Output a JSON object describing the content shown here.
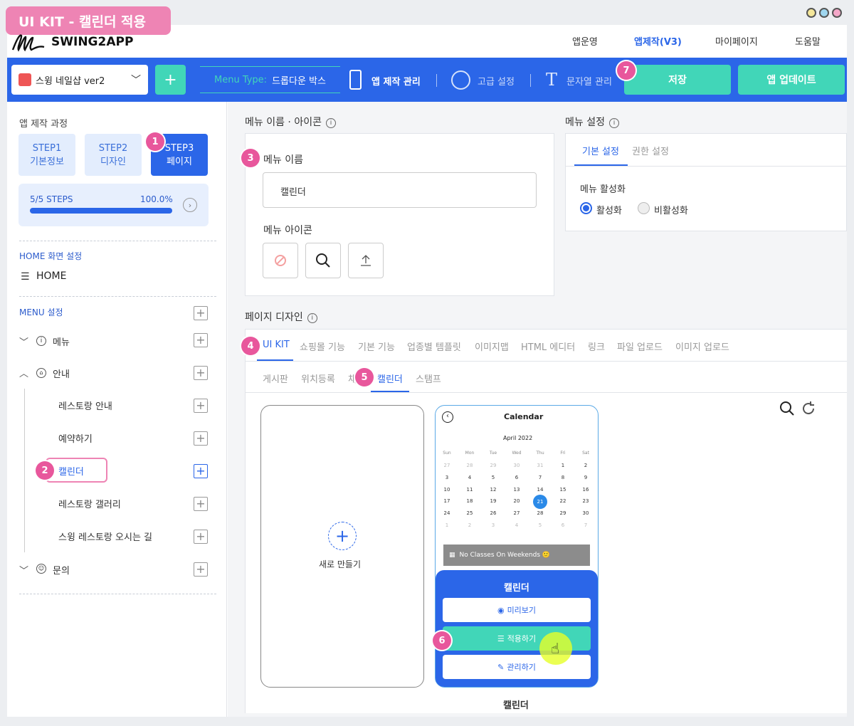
{
  "tag": "UI KIT - 캘린더 적용",
  "brand": "SWING2APP",
  "topnav": [
    "앱운영",
    "앱제작(V3)",
    "마이페이지",
    "도움말"
  ],
  "app_select": "스윙 네일샵 ver2",
  "add_label": "+",
  "menu_type_label": "Menu Type:",
  "menu_type_value": "드롭다운 박스",
  "app_manage": "앱 제작 관리",
  "advanced": "고급 설정",
  "strings_manage": "문자열 관리",
  "save": "저장",
  "update": "앱 업데이트",
  "badges": [
    "1",
    "2",
    "3",
    "4",
    "5",
    "6",
    "7"
  ],
  "sidebar": {
    "process_title": "앱 제작 과정",
    "steps": [
      [
        "STEP1",
        "기본정보"
      ],
      [
        "STEP2",
        "디자인"
      ],
      [
        "STEP3",
        "페이지"
      ]
    ],
    "progress_label": "5/5 STEPS",
    "progress_pct": "100.0%",
    "progress_value": 1.0,
    "home_title": "HOME 화면 설정",
    "home_item": "HOME",
    "menu_title": "MENU 설정",
    "tree": [
      "메뉴",
      "안내",
      "레스토랑 안내",
      "예약하기",
      "캘린더",
      "레스토랑 갤러리",
      "스윙 레스토랑 오시는 길",
      "문의"
    ]
  },
  "menu_name_icon": {
    "title": "메뉴 이름 · 아이콘",
    "name_label": "메뉴 이름",
    "name_value": "캘린더",
    "icon_label": "메뉴 아이콘"
  },
  "menu_settings": {
    "title": "메뉴 설정",
    "tabs": [
      "기본 설정",
      "권한 설정"
    ],
    "activate_label": "메뉴 활성화",
    "options": [
      "활성화",
      "비활성화"
    ]
  },
  "page_design": {
    "title": "페이지 디자인",
    "tabs": [
      "UI KIT",
      "쇼핑몰 기능",
      "기본 기능",
      "업종별 템플릿",
      "이미지맵",
      "HTML 에디터",
      "링크",
      "파일 업로드",
      "이미지 업로드"
    ],
    "subtabs": [
      "게시판",
      "위치등록",
      "채",
      "캘린더",
      "스탬프"
    ],
    "new_label": "새로 만들기",
    "card_caption": "캘린더"
  },
  "calendar": {
    "header": "Calendar",
    "month": "April 2022",
    "weekdays": [
      "Sun",
      "Mon",
      "Tue",
      "Wed",
      "Thu",
      "Fri",
      "Sat"
    ],
    "weeks": [
      [
        "27",
        "28",
        "29",
        "30",
        "31",
        "1",
        "2"
      ],
      [
        "3",
        "4",
        "5",
        "6",
        "7",
        "8",
        "9"
      ],
      [
        "10",
        "11",
        "12",
        "13",
        "14",
        "15",
        "16"
      ],
      [
        "17",
        "18",
        "19",
        "20",
        "21",
        "22",
        "23"
      ],
      [
        "24",
        "25",
        "26",
        "27",
        "28",
        "29",
        "30"
      ],
      [
        "1",
        "2",
        "3",
        "4",
        "5",
        "6",
        "7"
      ]
    ],
    "selected": "21",
    "notice": "No Classes On Weekends 🙂"
  },
  "overlay": {
    "title": "캘린더",
    "preview": "미리보기",
    "apply": "적용하기",
    "manage": "관리하기"
  },
  "colors": {
    "blue": "#2b66e8",
    "green": "#41d6b8",
    "pink": "#e8579c"
  }
}
